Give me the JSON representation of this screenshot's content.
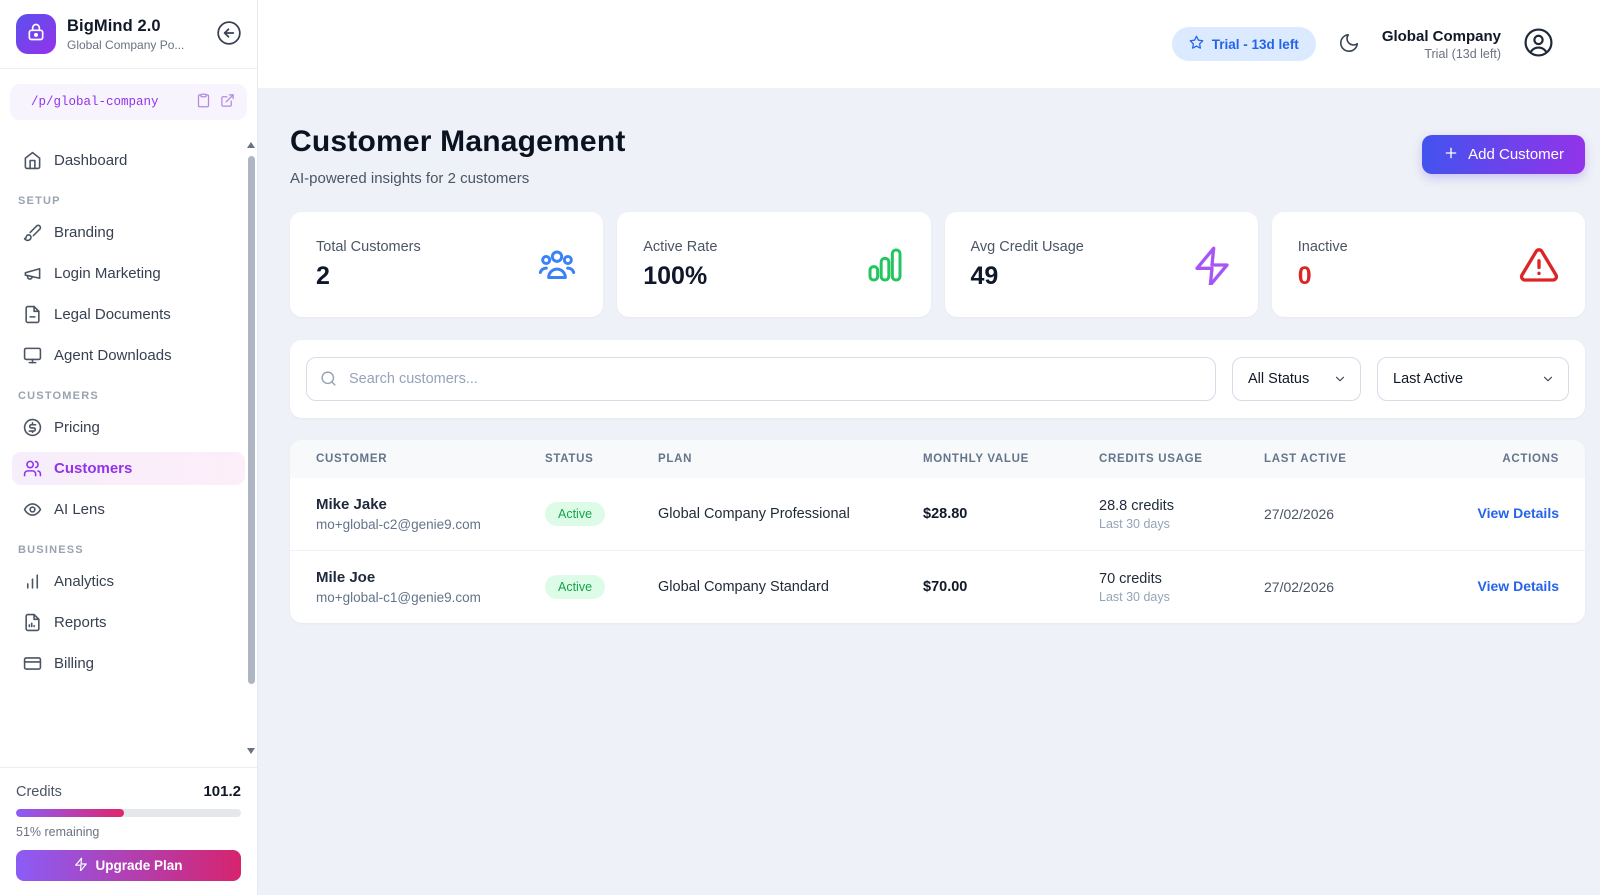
{
  "brand": {
    "name": "BigMind 2.0",
    "subtitle": "Global Company Po...",
    "logo_icon": "lock-icon"
  },
  "portal_link": {
    "url": "/p/global-company"
  },
  "sidebar": {
    "nav": [
      {
        "section": "",
        "items": [
          {
            "label": "Dashboard",
            "icon": "home-icon",
            "active": false
          }
        ]
      },
      {
        "section": "SETUP",
        "items": [
          {
            "label": "Branding",
            "icon": "paintbrush-icon",
            "active": false
          },
          {
            "label": "Login Marketing",
            "icon": "megaphone-icon",
            "active": false
          },
          {
            "label": "Legal Documents",
            "icon": "file-text-icon",
            "active": false
          },
          {
            "label": "Agent Downloads",
            "icon": "monitor-icon",
            "active": false
          }
        ]
      },
      {
        "section": "CUSTOMERS",
        "items": [
          {
            "label": "Pricing",
            "icon": "dollar-circle-icon",
            "active": false
          },
          {
            "label": "Customers",
            "icon": "users-icon",
            "active": true
          },
          {
            "label": "AI Lens",
            "icon": "eye-icon",
            "active": false
          }
        ]
      },
      {
        "section": "BUSINESS",
        "items": [
          {
            "label": "Analytics",
            "icon": "bar-chart-icon",
            "active": false
          },
          {
            "label": "Reports",
            "icon": "file-chart-icon",
            "active": false
          },
          {
            "label": "Billing",
            "icon": "credit-card-icon",
            "active": false
          }
        ]
      }
    ],
    "credits": {
      "label": "Credits",
      "value": "101.2",
      "remaining": "51% remaining",
      "progress_pct": 48,
      "upgrade_label": "Upgrade Plan"
    }
  },
  "topbar": {
    "trial_badge": "Trial - 13d left",
    "account_name": "Global Company",
    "account_status": "Trial (13d left)"
  },
  "page": {
    "title": "Customer Management",
    "subtitle": "AI-powered insights for 2 customers",
    "add_customer_label": "Add Customer"
  },
  "stats": [
    {
      "label": "Total Customers",
      "value": "2",
      "icon": "users-group-icon",
      "icon_color": "#3b82f6",
      "value_color": "#0f172a"
    },
    {
      "label": "Active Rate",
      "value": "100%",
      "icon": "signal-bars-icon",
      "icon_color": "#22c55e",
      "value_color": "#0f172a"
    },
    {
      "label": "Avg Credit Usage",
      "value": "49",
      "icon": "zap-icon",
      "icon_color": "#a855f7",
      "value_color": "#0f172a"
    },
    {
      "label": "Inactive",
      "value": "0",
      "icon": "alert-triangle-icon",
      "icon_color": "#dc2626",
      "value_color": "#dc2626"
    }
  ],
  "filters": {
    "search_placeholder": "Search customers...",
    "status": "All Status",
    "sort": "Last Active"
  },
  "table": {
    "columns": [
      "CUSTOMER",
      "STATUS",
      "PLAN",
      "MONTHLY VALUE",
      "CREDITS USAGE",
      "LAST ACTIVE",
      "ACTIONS"
    ],
    "rows": [
      {
        "name": "Mike Jake",
        "email": "mo+global-c2@genie9.com",
        "status": "Active",
        "plan": "Global Company Professional",
        "monthly_value": "$28.80",
        "credits": "28.8 credits",
        "credits_sub": "Last 30 days",
        "last_active": "27/02/2026",
        "action": "View Details"
      },
      {
        "name": "Mile Joe",
        "email": "mo+global-c1@genie9.com",
        "status": "Active",
        "plan": "Global Company Standard",
        "monthly_value": "$70.00",
        "credits": "70 credits",
        "credits_sub": "Last 30 days",
        "last_active": "27/02/2026",
        "action": "View Details"
      }
    ]
  },
  "colors": {
    "logo_gradient": [
      "#5b50ee",
      "#9333ea"
    ],
    "add_button_gradient": [
      "#4353ee",
      "#9333ea"
    ],
    "upgrade_gradient": [
      "#8b5cf6",
      "#d6246e"
    ],
    "progress_gradient": [
      "#8b5cf6",
      "#e1246e"
    ],
    "trial_badge_bg": "#dbeafe",
    "trial_badge_text": "#2563eb",
    "active_badge_bg": "#dcfce7",
    "active_badge_text": "#16a34a",
    "link": "#2563eb",
    "page_bg": "#eef1f7"
  }
}
